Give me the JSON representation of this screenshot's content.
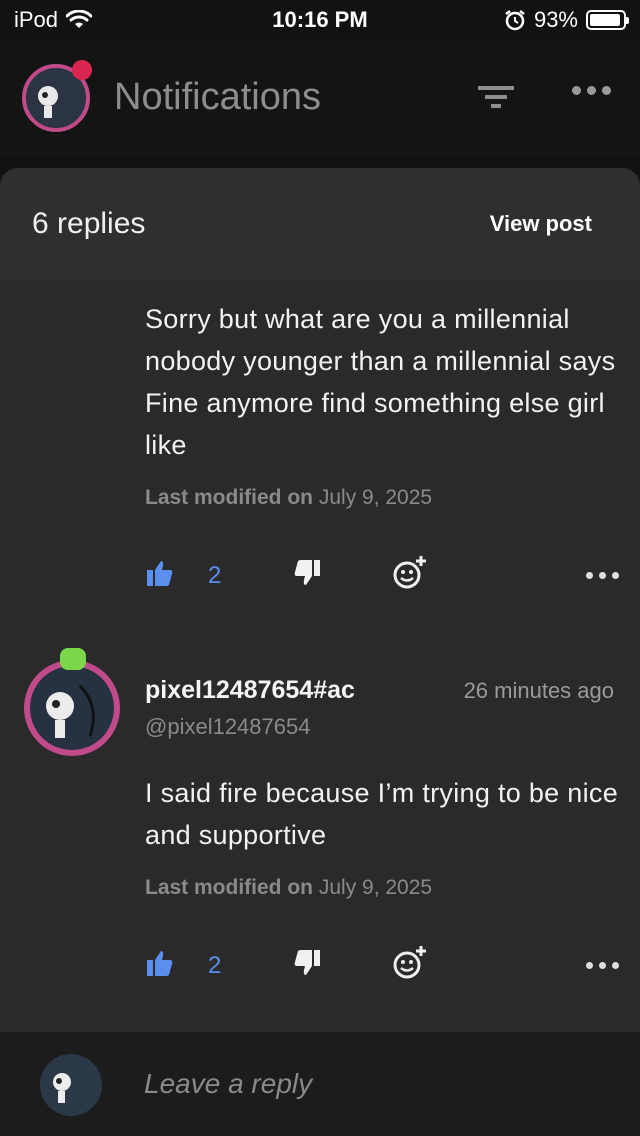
{
  "status_bar": {
    "device": "iPod",
    "time": "10:16 PM",
    "battery": "93%",
    "battery_level": 0.93
  },
  "header": {
    "title": "Notifications"
  },
  "sheet": {
    "replies_count": "6 replies",
    "view_post": "View post"
  },
  "comments": [
    {
      "text": "Sorry but what are you a millennial nobody younger than a millennial says Fine anymore find something else girl like",
      "modified_label": "Last modified on",
      "modified_date": "July 9, 2025",
      "likes": "2"
    },
    {
      "username": "pixel12487654#ac",
      "handle": "@pixel12487654",
      "time": "26 minutes ago",
      "text": "I said fire because I’m trying to be nice and supportive",
      "modified_label": "Last modified on",
      "modified_date": "July 9, 2025",
      "likes": "2"
    }
  ],
  "reply": {
    "placeholder": "Leave a reply"
  },
  "colors": {
    "accent_blue": "#5a8ff0",
    "avatar_ring": "#c04a8a",
    "notification_dot": "#d9264f"
  }
}
